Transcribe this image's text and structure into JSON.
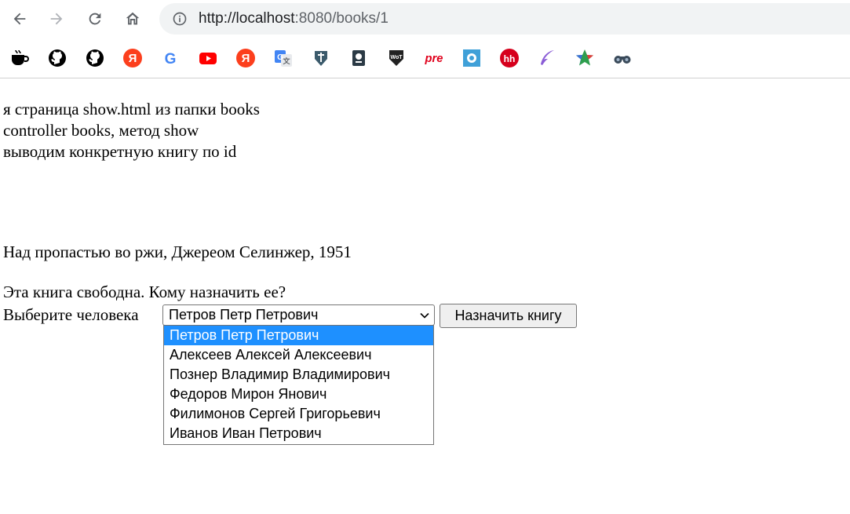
{
  "browser": {
    "url_host": "http://localhost",
    "url_rest": ":8080/books/1",
    "nav": {
      "back_icon": "arrow-left-icon",
      "forward_icon": "arrow-right-icon",
      "reload_icon": "reload-icon",
      "home_icon": "home-icon"
    },
    "bookmarks": [
      {
        "icon": "coffee-cup-icon",
        "color": "#000000"
      },
      {
        "icon": "github-icon",
        "color": "#000000"
      },
      {
        "icon": "github-icon",
        "color": "#000000"
      },
      {
        "icon": "yandex-icon",
        "color": "#fc3f1d",
        "glyph": "Я"
      },
      {
        "icon": "google-icon",
        "color": "#4285f4",
        "glyph": "G"
      },
      {
        "icon": "youtube-icon",
        "color": "#ff0000"
      },
      {
        "icon": "yandex-icon",
        "color": "#fc3f1d",
        "glyph": "Я"
      },
      {
        "icon": "google-translate-icon",
        "color": "#4285f4"
      },
      {
        "icon": "warships-icon",
        "color": "#3b5a6b"
      },
      {
        "icon": "book-icon",
        "color": "#2b3a45"
      },
      {
        "icon": "tanks-icon",
        "color": "#222222"
      },
      {
        "icon": "pre-icon",
        "color": "#e0001b",
        "glyph": "pre"
      },
      {
        "icon": "splash-icon",
        "color": "#3fa0d8"
      },
      {
        "icon": "hh-icon",
        "color": "#d6001c",
        "glyph": "hh"
      },
      {
        "icon": "feather-icon",
        "color": "#8a5cd6"
      },
      {
        "icon": "star-icon",
        "color": "#e23b3b"
      },
      {
        "icon": "binoculars-icon",
        "color": "#3a4a5a"
      }
    ]
  },
  "page": {
    "intro_lines": [
      "я страница show.html из папки books",
      "controller books, метод show",
      "выводим конкретную книгу по id"
    ],
    "book_info": "Над пропастью во ржи, Джереом Селинжер, 1951",
    "free_text": "Эта книга свободна. Кому назначить ее?",
    "choose_label": "Выберите человека",
    "select_value": "Петров Петр Петрович",
    "assign_button": "Назначить книгу",
    "options": [
      "Петров Петр Петрович",
      "Алексеев Алексей Алексеевич",
      "Познер Владимир Владимирович",
      "Федоров Мирон Янович",
      "Филимонов Сергей Григорьевич",
      "Иванов Иван Петрович"
    ],
    "selected_index": 0,
    "highlight_color": "#1e90ff"
  }
}
